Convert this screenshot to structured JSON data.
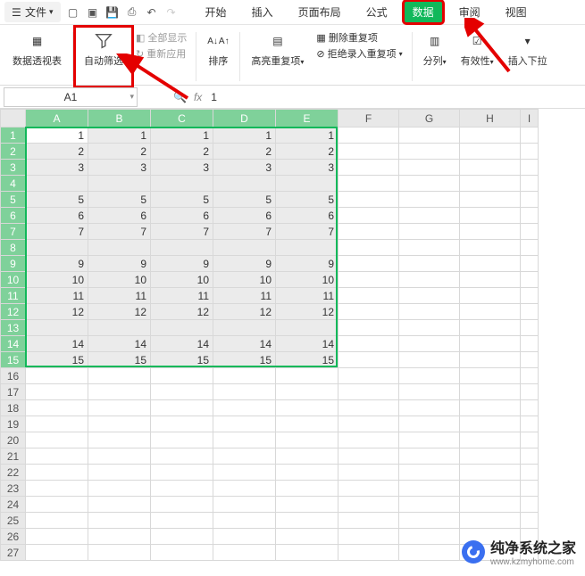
{
  "menubar": {
    "file_label": "文件",
    "tabs": [
      "开始",
      "插入",
      "页面布局",
      "公式",
      "数据",
      "审阅",
      "视图"
    ],
    "active_tab_index": 4
  },
  "ribbon": {
    "pivot_label": "数据透视表",
    "autofilter_label": "自动筛选",
    "showall_label": "全部显示",
    "reapply_label": "重新应用",
    "sort_label": "排序",
    "highlight_dup_label": "高亮重复项",
    "remove_dup_label": "删除重复项",
    "reject_dup_label": "拒绝录入重复项",
    "text_to_cols_label": "分列",
    "validity_label": "有效性",
    "insert_dropdown_label": "插入下拉"
  },
  "formulabar": {
    "namebox_value": "A1",
    "fx_label": "fx",
    "formula_value": "1"
  },
  "grid": {
    "columns": [
      "A",
      "B",
      "C",
      "D",
      "E",
      "F",
      "G",
      "H",
      "I"
    ],
    "row_count": 27,
    "selection": {
      "r1": 1,
      "c1": 1,
      "r2": 15,
      "c2": 5
    },
    "active": {
      "r": 1,
      "c": 1
    },
    "data_rows": [
      1,
      2,
      3,
      5,
      6,
      7,
      9,
      10,
      11,
      12,
      14,
      15
    ],
    "data_cols": 5
  },
  "watermark": {
    "title": "纯净系统之家",
    "url": "www.kzmyhome.com"
  },
  "annotations": {
    "boxed_ribbon_group": "autofilter",
    "boxed_tab": "数据"
  }
}
